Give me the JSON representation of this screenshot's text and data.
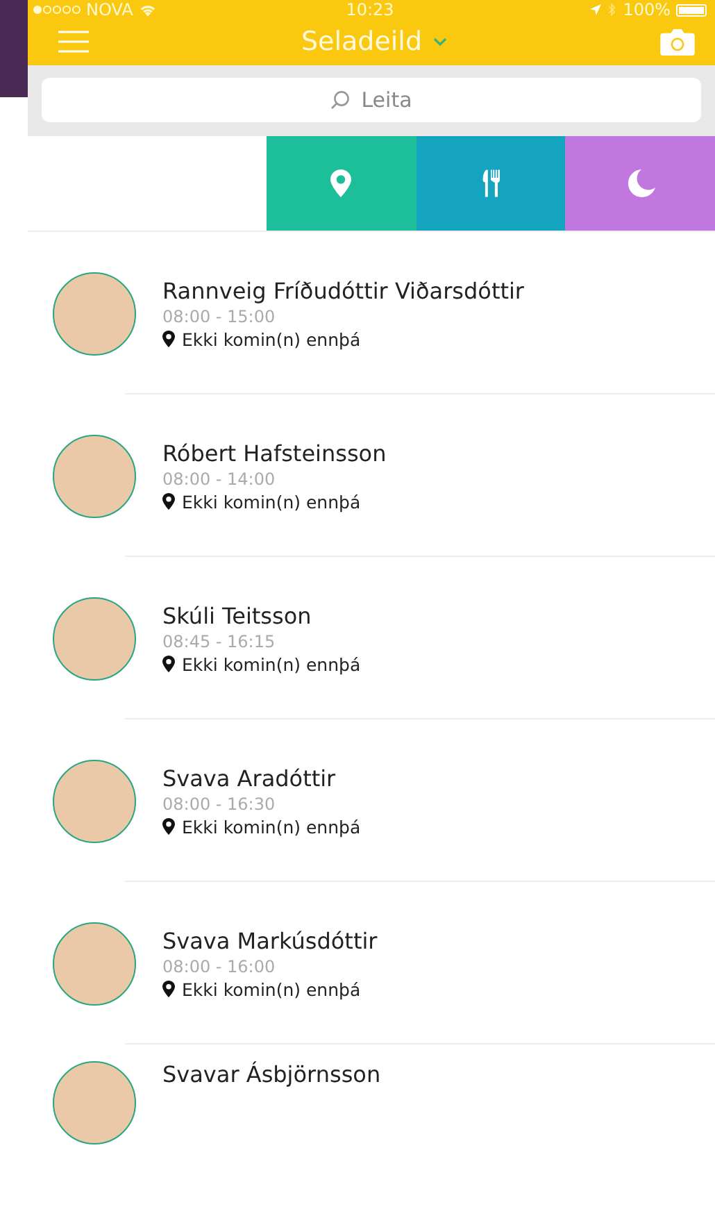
{
  "status_bar": {
    "carrier": "NOVA",
    "time": "10:23",
    "battery": "100%"
  },
  "nav_bar": {
    "title": "Seladeild"
  },
  "search": {
    "placeholder": "Leita"
  },
  "swipe_actions": [
    {
      "kind": "location",
      "color": "#1dbf9a"
    },
    {
      "kind": "meal",
      "color": "#14a4bf"
    },
    {
      "kind": "sleep",
      "color": "#c078e0"
    }
  ],
  "children": [
    {
      "name": "Rannveig Fríðudóttir Viðarsdóttir",
      "hours": "08:00 - 15:00",
      "status": "Ekki komin(n) ennþá"
    },
    {
      "name": "Róbert Hafsteinsson",
      "hours": "08:00 - 14:00",
      "status": "Ekki komin(n) ennþá"
    },
    {
      "name": "Skúli Teitsson",
      "hours": "08:45 - 16:15",
      "status": "Ekki komin(n) ennþá"
    },
    {
      "name": "Svava Aradóttir",
      "hours": "08:00 - 16:30",
      "status": "Ekki komin(n) ennþá"
    },
    {
      "name": "Svava Markúsdóttir",
      "hours": "08:00 - 16:00",
      "status": "Ekki komin(n) ennþá"
    },
    {
      "name": "Svavar Ásbjörnsson"
    }
  ]
}
